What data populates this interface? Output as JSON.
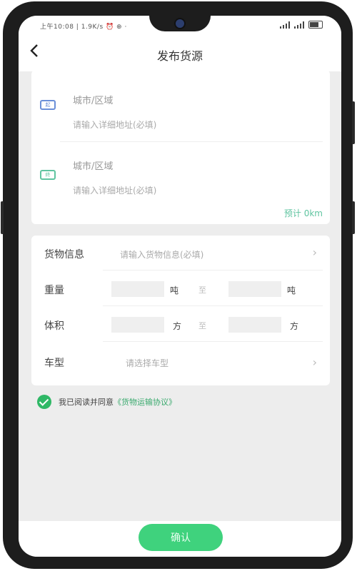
{
  "status_bar": {
    "left_text": "上午10:08 | 1.9K/s ⏰ ⊕ ·"
  },
  "header": {
    "back_icon": "chevron-left-icon",
    "title": "发布货源"
  },
  "route": {
    "origin": {
      "city_label": "城市/区域",
      "address_placeholder": "请输入详细地址(必填)"
    },
    "destination": {
      "city_label": "城市/区域",
      "address_placeholder": "请输入详细地址(必填)"
    },
    "estimate_label": "预计 0km"
  },
  "form": {
    "goods_info": {
      "label": "货物信息",
      "placeholder": "请输入货物信息(必填)"
    },
    "weight": {
      "label": "重量",
      "unit": "吨",
      "to": "至"
    },
    "volume": {
      "label": "体积",
      "unit": "方",
      "to": "至"
    },
    "vehicle_type": {
      "label": "车型",
      "placeholder": "请选择车型"
    }
  },
  "agreement": {
    "prefix": "我已阅读并同意",
    "link": "《货物运输协议》"
  },
  "confirm_label": "确认",
  "colors": {
    "accent": "#3fd27d",
    "check": "#2fb866",
    "estimate": "#5fc4a0",
    "background": "#ededed"
  }
}
